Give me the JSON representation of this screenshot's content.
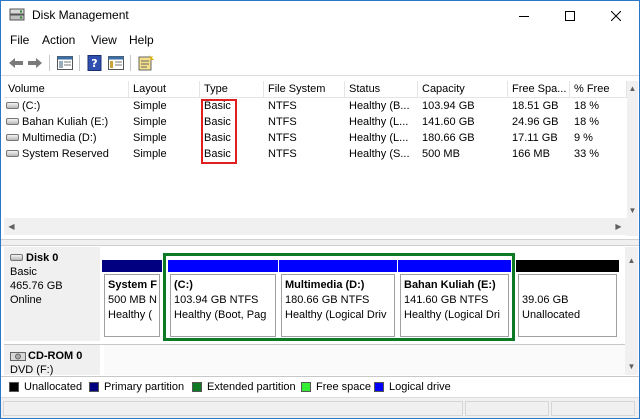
{
  "window": {
    "title": "Disk Management",
    "minimize_icon": "minimize-icon",
    "maximize_icon": "maximize-icon",
    "close_icon": "close-icon"
  },
  "menu": [
    "File",
    "Action",
    "View",
    "Help"
  ],
  "toolbar": {
    "icons": [
      "back-arrow-icon",
      "forward-arrow-icon",
      "console-tree-icon",
      "help-icon",
      "properties-icon",
      "wizard-icon"
    ]
  },
  "volume_list": {
    "columns": [
      "Volume",
      "Layout",
      "Type",
      "File System",
      "Status",
      "Capacity",
      "Free Spa...",
      "% Free"
    ],
    "rows": [
      [
        "(C:)",
        "Simple",
        "Basic",
        "NTFS",
        "Healthy (B...",
        "103.94 GB",
        "18.51 GB",
        "18 %"
      ],
      [
        "Bahan Kuliah (E:)",
        "Simple",
        "Basic",
        "NTFS",
        "Healthy (L...",
        "141.60 GB",
        "24.96 GB",
        "18 %"
      ],
      [
        "Multimedia (D:)",
        "Simple",
        "Basic",
        "NTFS",
        "Healthy (L...",
        "180.66 GB",
        "17.11 GB",
        "9 %"
      ],
      [
        "System Reserved",
        "Simple",
        "Basic",
        "NTFS",
        "Healthy (S...",
        "500 MB",
        "166 MB",
        "33 %"
      ]
    ]
  },
  "disks": [
    {
      "name": "Disk 0",
      "type": "Basic",
      "size": "465.76 GB",
      "status": "Online",
      "partitions": [
        {
          "title": "System F",
          "size": "500 MB N",
          "status": "Healthy (",
          "bar_color": "#000080"
        },
        {
          "title": "(C:)",
          "size": "103.94 GB NTFS",
          "status": "Healthy (Boot, Pag",
          "bar_color": "#0000ff"
        },
        {
          "title": "Multimedia  (D:)",
          "size": "180.66 GB NTFS",
          "status": "Healthy (Logical Driv",
          "bar_color": "#0000ff"
        },
        {
          "title": "Bahan Kuliah  (E:)",
          "size": "141.60 GB NTFS",
          "status": "Healthy (Logical Dri",
          "bar_color": "#0000ff"
        },
        {
          "title": "",
          "size": "39.06 GB",
          "status": "Unallocated",
          "bar_color": "#000000"
        }
      ]
    },
    {
      "name": "CD-ROM 0",
      "type": "DVD (F:)"
    }
  ],
  "legend": [
    {
      "label": "Unallocated",
      "color": "#000000"
    },
    {
      "label": "Primary partition",
      "color": "#000080"
    },
    {
      "label": "Extended partition",
      "color": "#0c7a24"
    },
    {
      "label": "Free space",
      "color": "#33ee33"
    },
    {
      "label": "Logical drive",
      "color": "#0000ff"
    }
  ]
}
